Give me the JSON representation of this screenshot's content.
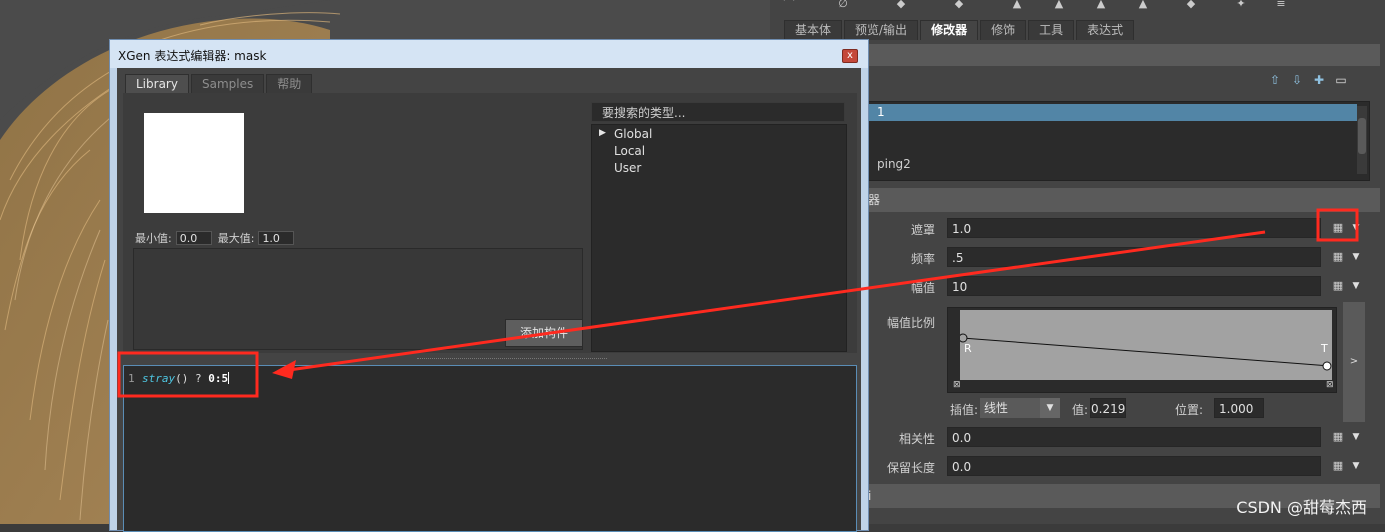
{
  "right_panel": {
    "tabs": [
      {
        "label": "基本体"
      },
      {
        "label": "预览/输出"
      },
      {
        "label": "修改器"
      },
      {
        "label": "修饰"
      },
      {
        "label": "工具"
      },
      {
        "label": "表达式"
      }
    ],
    "active_tab_index": 2,
    "tree_items": {
      "selected": "1",
      "item2": "ping2"
    },
    "section_title": "器",
    "attributes": {
      "mask": {
        "label": "遮罩",
        "value": "1.0"
      },
      "frequency": {
        "label": "频率",
        "value": ".5"
      },
      "magnitude": {
        "label": "幅值",
        "value": "10"
      },
      "magnitude_scale": {
        "label": "幅值比例"
      },
      "correlation": {
        "label": "相关性",
        "value": "0.0"
      },
      "preserve_length": {
        "label": "保留长度",
        "value": "0.0"
      }
    },
    "ramp": {
      "left_label": "R",
      "right_label": "T",
      "interp_label": "插值:",
      "interp_value": "线性",
      "value_label": "值:",
      "value": "0.219",
      "position_label": "位置:",
      "position": "1.000",
      "expand_glyph": ">"
    },
    "bottom_bar_label": "i"
  },
  "editor": {
    "title": "XGen 表达式编辑器: mask",
    "close_glyph": "x",
    "tabs": [
      {
        "label": "Library"
      },
      {
        "label": "Samples"
      },
      {
        "label": "帮助"
      }
    ],
    "active_tab_index": 0,
    "min_label": "最小值:",
    "min_value": "0.0",
    "max_label": "最大值:",
    "max_value": "1.0",
    "add_button": "添加构件",
    "search_placeholder": "要搜索的类型...",
    "types": [
      "Global",
      "Local",
      "User"
    ],
    "code": {
      "line_number": "1",
      "fn": "stray",
      "parens": "()",
      "operator": " ? ",
      "value": "0:5"
    }
  },
  "watermark": "CSDN @甜莓杰西",
  "colors": {
    "annotation_red": "#ff2a1f",
    "selection_blue": "#5285a6",
    "code_function": "#4ec5e0"
  }
}
